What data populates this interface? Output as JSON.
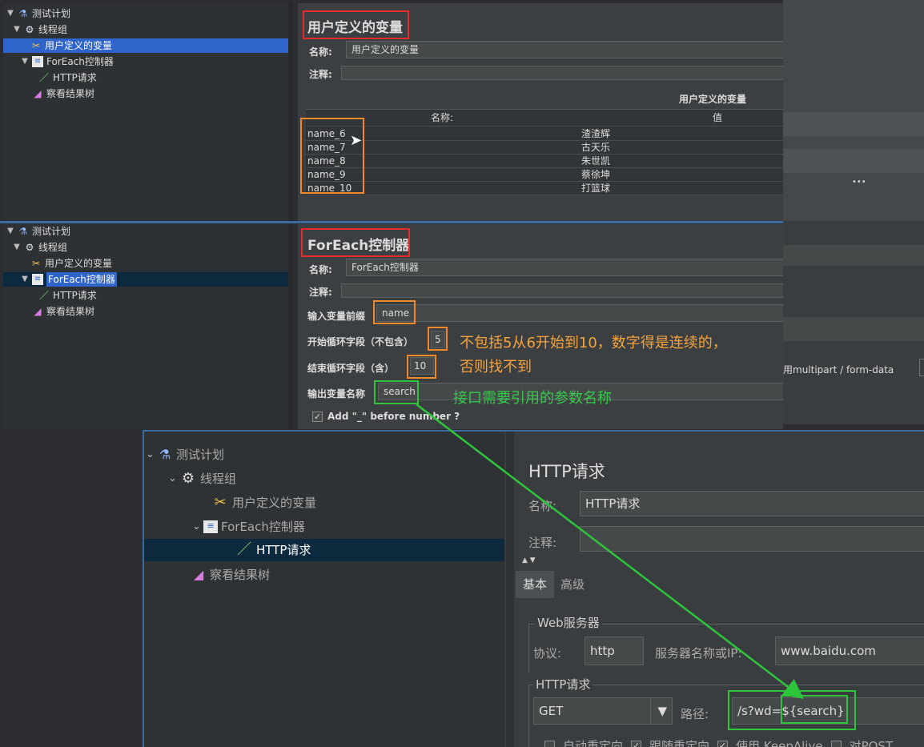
{
  "top": {
    "tree": [
      "测试计划",
      "线程组",
      "用户定义的变量",
      "ForEach控制器",
      "HTTP请求",
      "察看结果树"
    ],
    "title": "用户定义的变量",
    "name_label": "名称:",
    "name_value": "用户定义的变量",
    "comment_label": "注释:",
    "table_title": "用户定义的变量",
    "col_name": "名称:",
    "col_value": "值",
    "rows": [
      {
        "name": "name_6",
        "value": "渣渣辉"
      },
      {
        "name": "name_7",
        "value": "古天乐"
      },
      {
        "name": "name_8",
        "value": "朱世凯"
      },
      {
        "name": "name_9",
        "value": "蔡徐坤"
      },
      {
        "name": "name_10",
        "value": "打篮球"
      }
    ],
    "ellipsis": "•••"
  },
  "mid": {
    "tree": [
      "测试计划",
      "线程组",
      "用户定义的变量",
      "ForEach控制器",
      "HTTP请求",
      "察看结果树"
    ],
    "title": "ForEach控制器",
    "name_label": "名称:",
    "name_value": "ForEach控制器",
    "comment_label": "注释:",
    "prefix_label": "输入变量前缀",
    "prefix_value": "name",
    "start_label": "开始循环字段（不包含）",
    "start_value": "5",
    "end_label": "结束循环字段（含）",
    "end_value": "10",
    "output_label": "输出变量名称",
    "output_value": "search",
    "add_label": "Add \"_\" before number ?",
    "multipart_label": "用multipart / form-data"
  },
  "annotations": {
    "note1_line1": "不包括5从6开始到10，数字得是连续的，",
    "note1_line2": "否则找不到",
    "note2": "接口需要引用的参数名称"
  },
  "bottom": {
    "tree": [
      "测试计划",
      "线程组",
      "用户定义的变量",
      "ForEach控制器",
      "HTTP请求",
      "察看结果树"
    ],
    "title": "HTTP请求",
    "name_label": "名称:",
    "name_value": "HTTP请求",
    "comment_label": "注释:",
    "tab_basic": "基本",
    "tab_advanced": "高级",
    "web_server_legend": "Web服务器",
    "protocol_label": "协议:",
    "protocol_value": "http",
    "server_label": "服务器名称或IP:",
    "server_value": "www.baidu.com",
    "http_legend": "HTTP请求",
    "method_value": "GET",
    "path_label": "路径:",
    "path_prefix": "/s?wd=",
    "path_var": "${search}",
    "cb1": "自动重定向",
    "cb2": "跟随重定向",
    "cb3": "使用 KeepAlive",
    "cb4": "对POST"
  }
}
